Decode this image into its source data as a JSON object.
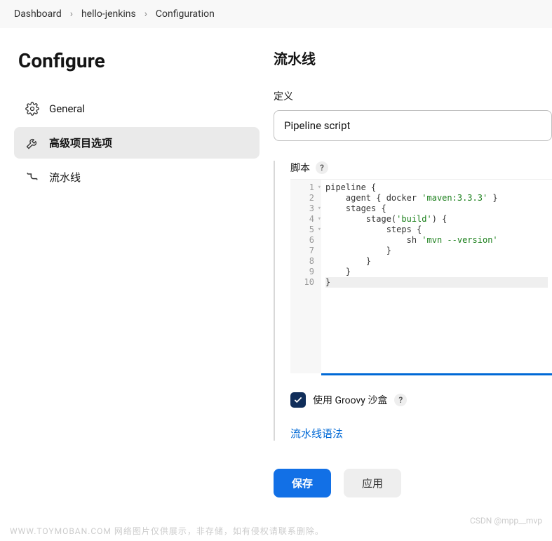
{
  "breadcrumb": [
    "Dashboard",
    "hello-jenkins",
    "Configuration"
  ],
  "page_title": "Configure",
  "sidebar": {
    "items": [
      {
        "label": "General",
        "icon": "gear-icon",
        "active": false
      },
      {
        "label": "高级项目选项",
        "icon": "wrench-icon",
        "active": true
      },
      {
        "label": "流水线",
        "icon": "pipeline-icon",
        "active": false
      }
    ]
  },
  "main": {
    "section_title": "流水线",
    "definition_label": "定义",
    "definition_value": "Pipeline script",
    "script_label": "脚本",
    "help_glyph": "?",
    "code_lines": [
      {
        "n": 1,
        "fold": true,
        "segments": [
          {
            "t": "pipeline {"
          }
        ]
      },
      {
        "n": 2,
        "fold": false,
        "segments": [
          {
            "t": "    agent { docker "
          },
          {
            "t": "'maven:3.3.3'",
            "cls": "str"
          },
          {
            "t": " }"
          }
        ]
      },
      {
        "n": 3,
        "fold": true,
        "segments": [
          {
            "t": "    stages {"
          }
        ]
      },
      {
        "n": 4,
        "fold": true,
        "segments": [
          {
            "t": "        stage("
          },
          {
            "t": "'build'",
            "cls": "str"
          },
          {
            "t": ") {"
          }
        ]
      },
      {
        "n": 5,
        "fold": true,
        "segments": [
          {
            "t": "            steps {"
          }
        ]
      },
      {
        "n": 6,
        "fold": false,
        "segments": [
          {
            "t": "                sh "
          },
          {
            "t": "'mvn --version'",
            "cls": "str"
          }
        ]
      },
      {
        "n": 7,
        "fold": false,
        "segments": [
          {
            "t": "            }"
          }
        ]
      },
      {
        "n": 8,
        "fold": false,
        "segments": [
          {
            "t": "        }"
          }
        ]
      },
      {
        "n": 9,
        "fold": false,
        "segments": [
          {
            "t": "    }"
          }
        ]
      },
      {
        "n": 10,
        "fold": false,
        "segments": [
          {
            "t": "}"
          }
        ],
        "hl": true
      }
    ],
    "sandbox_label": "使用 Groovy 沙盒",
    "sandbox_checked": true,
    "syntax_link": "流水线语法",
    "save_label": "保存",
    "apply_label": "应用"
  },
  "watermark_left": "WWW.TOYMOBAN.COM  网络图片仅供展示，非存储，如有侵权请联系删除。",
  "watermark_right": "CSDN @mpp__mvp"
}
